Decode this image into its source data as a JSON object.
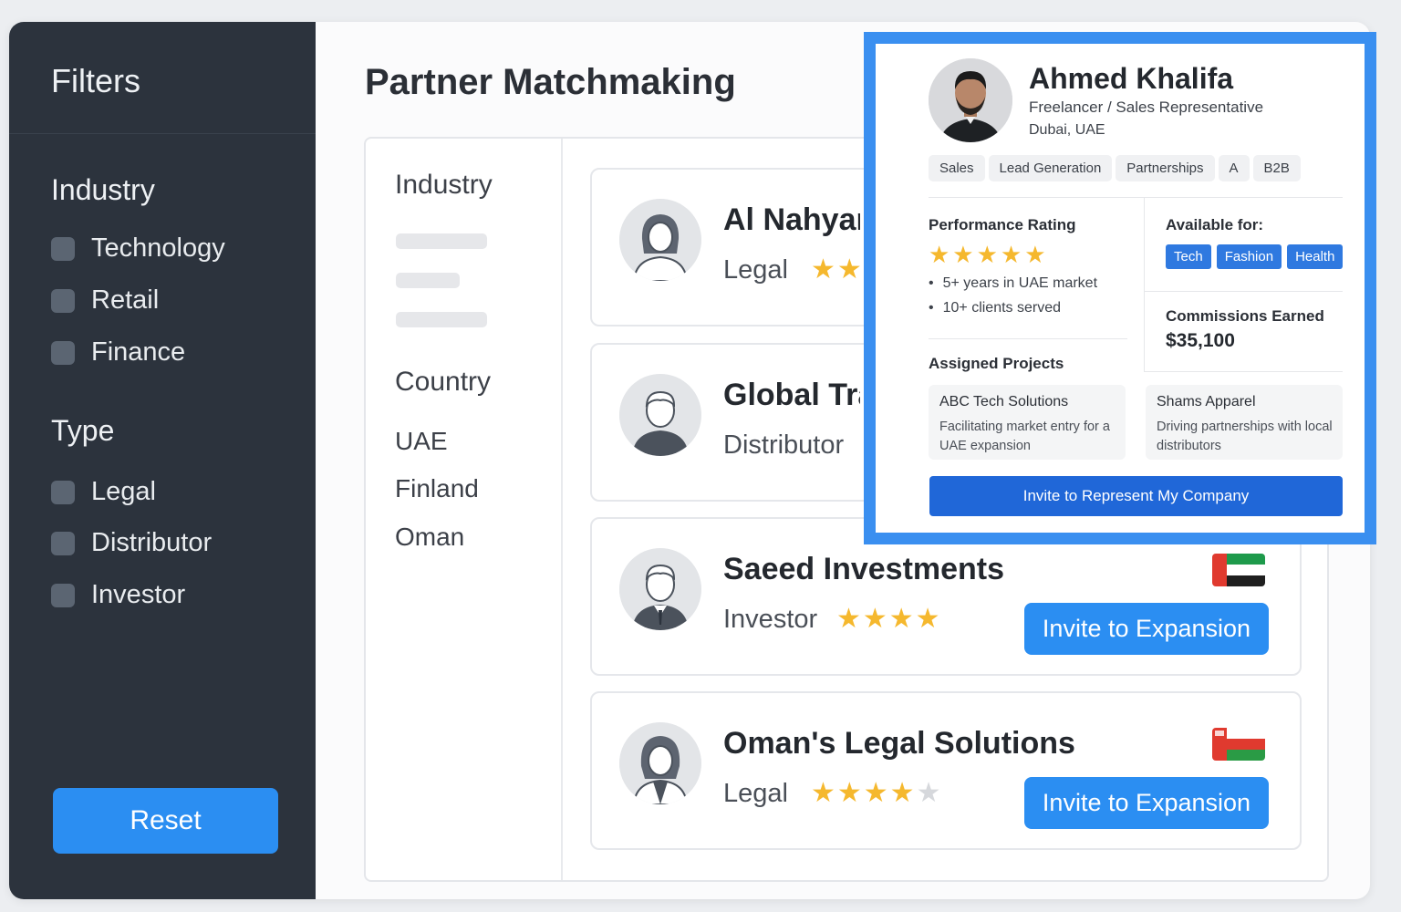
{
  "sidebar": {
    "title": "Filters",
    "industry_heading": "Industry",
    "industry_options": [
      "Technology",
      "Retail",
      "Finance"
    ],
    "type_heading": "Type",
    "type_options": [
      "Legal",
      "Distributor",
      "Investor"
    ],
    "reset_label": "Reset"
  },
  "main": {
    "title": "Partner Matchmaking",
    "filters": {
      "industry_label": "Industry",
      "country_label": "Country",
      "countries": [
        "UAE",
        "Finland",
        "Oman"
      ]
    },
    "partners": [
      {
        "name": "Al Nahyan",
        "type": "Legal",
        "rating": 2,
        "stars": "★★"
      },
      {
        "name": "Global Tra",
        "type": "Distributor"
      },
      {
        "name": "Saeed Investments",
        "type": "Investor",
        "rating": 4,
        "stars": "★★★★",
        "flag": "uae-flag-icon",
        "button": "Invite to Expansion"
      },
      {
        "name": "Oman's Legal Solutions",
        "type": "Legal",
        "rating": 4,
        "max_rating": 5,
        "stars_on": "★★★★",
        "stars_off": "★",
        "flag": "oman-flag-icon",
        "button": "Invite to Expansion"
      }
    ]
  },
  "profile": {
    "name": "Ahmed Khalifa",
    "role": "Freelancer / Sales Representative",
    "location": "Dubai, UAE",
    "tags": [
      "Sales",
      "Lead Generation",
      "Partnerships",
      "A",
      "B2B"
    ],
    "performance_heading": "Performance Rating",
    "performance_rating": 5,
    "performance_stars": "★★★★★",
    "highlights": [
      "5+ years in UAE market",
      "10+ clients served"
    ],
    "available_heading": "Available for:",
    "available_for": [
      "Tech",
      "Fashion",
      "Health"
    ],
    "commissions_heading": "Commissions Earned",
    "commissions_value": "$35,100",
    "projects_heading": "Assigned Projects",
    "projects": [
      {
        "title": "ABC Tech Solutions",
        "desc": "Facilitating market entry for a UAE expansion"
      },
      {
        "title": "Shams Apparel",
        "desc": "Driving partnerships with local distributors"
      }
    ],
    "cta": "Invite to Represent My Company"
  },
  "colors": {
    "sidebar_bg": "#2c333d",
    "accent_blue": "#2b8ef2",
    "overlay_border": "#3a8ff0",
    "star": "#f5b82e",
    "cta_blue": "#2067d8"
  }
}
